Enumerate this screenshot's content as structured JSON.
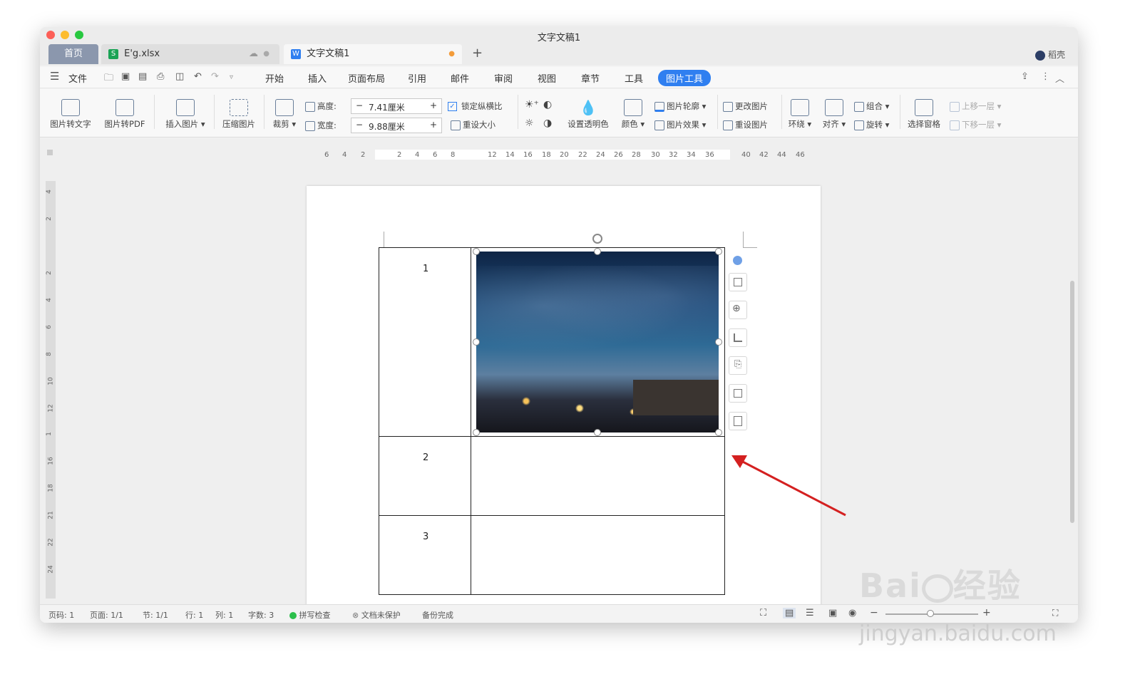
{
  "window": {
    "title": "文字文稿1"
  },
  "tabs": [
    {
      "label": "首页"
    },
    {
      "label": "E'g.xlsx"
    },
    {
      "label": "文字文稿1"
    }
  ],
  "tab_add": "+",
  "account": "稻壳",
  "menu": {
    "items": [
      "文件",
      "开始",
      "插入",
      "页面布局",
      "引用",
      "邮件",
      "审阅",
      "视图",
      "章节",
      "工具",
      "图片工具"
    ]
  },
  "ribbon": {
    "pic_to_text": "图片转文字",
    "pic_to_pdf": "图片转PDF",
    "insert_pic": "插入图片",
    "compress": "压缩图片",
    "crop": "裁剪",
    "height_label": "高度:",
    "height_value": "7.41厘米",
    "width_label": "宽度:",
    "width_value": "9.88厘米",
    "lock_ratio": "锁定纵横比",
    "reset_size": "重设大小",
    "set_transparent": "设置透明色",
    "color": "颜色",
    "outline": "图片轮廓",
    "effect": "图片效果",
    "change_pic": "更改图片",
    "reset_pic": "重设图片",
    "wrap": "环绕",
    "align": "对齐",
    "group": "组合",
    "rotate": "旋转",
    "selection_pane": "选择窗格",
    "bring_forward": "上移一层",
    "send_backward": "下移一层",
    "minus": "−",
    "plus": "+"
  },
  "ruler_labels": [
    "6",
    "4",
    "2",
    "2",
    "4",
    "6",
    "8",
    "12",
    "14",
    "16",
    "18",
    "20",
    "22",
    "24",
    "26",
    "28",
    "30",
    "32",
    "34",
    "36",
    "40",
    "42",
    "44",
    "46"
  ],
  "vruler_labels": [
    "4",
    "2",
    "2",
    "4",
    "6",
    "8",
    "10",
    "12",
    "1",
    "16",
    "18",
    "21",
    "22",
    "24"
  ],
  "table": {
    "rows": [
      "1",
      "2",
      "3"
    ]
  },
  "status": {
    "page_num": "页码: 1",
    "pages": "页面: 1/1",
    "section": "节: 1/1",
    "row": "行: 1",
    "col": "列: 1",
    "words": "字数: 3",
    "spell": "拼写检查",
    "protect": "文档未保护",
    "backup": "备份完成"
  },
  "watermark": {
    "text": "jingyan.baidu.com"
  },
  "colors": {
    "accent": "#2f7ff0",
    "arrow": "#d42020",
    "tab_active": "#f7f7f7",
    "tab_home": "#8b97ad"
  }
}
